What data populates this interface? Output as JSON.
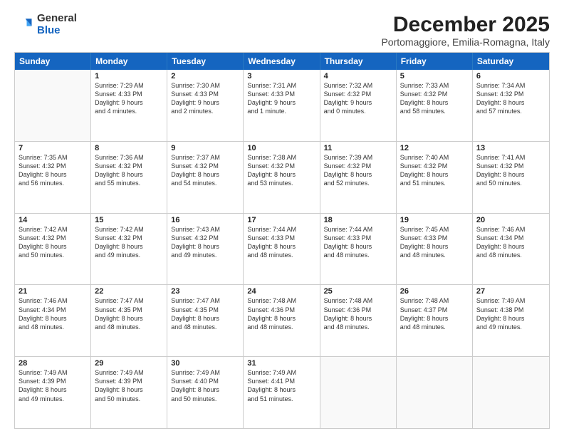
{
  "logo": {
    "general": "General",
    "blue": "Blue"
  },
  "title": "December 2025",
  "subtitle": "Portomaggiore, Emilia-Romagna, Italy",
  "header_days": [
    "Sunday",
    "Monday",
    "Tuesday",
    "Wednesday",
    "Thursday",
    "Friday",
    "Saturday"
  ],
  "rows": [
    [
      {
        "day": "",
        "lines": [],
        "empty": true
      },
      {
        "day": "1",
        "lines": [
          "Sunrise: 7:29 AM",
          "Sunset: 4:33 PM",
          "Daylight: 9 hours",
          "and 4 minutes."
        ]
      },
      {
        "day": "2",
        "lines": [
          "Sunrise: 7:30 AM",
          "Sunset: 4:33 PM",
          "Daylight: 9 hours",
          "and 2 minutes."
        ]
      },
      {
        "day": "3",
        "lines": [
          "Sunrise: 7:31 AM",
          "Sunset: 4:33 PM",
          "Daylight: 9 hours",
          "and 1 minute."
        ]
      },
      {
        "day": "4",
        "lines": [
          "Sunrise: 7:32 AM",
          "Sunset: 4:32 PM",
          "Daylight: 9 hours",
          "and 0 minutes."
        ]
      },
      {
        "day": "5",
        "lines": [
          "Sunrise: 7:33 AM",
          "Sunset: 4:32 PM",
          "Daylight: 8 hours",
          "and 58 minutes."
        ]
      },
      {
        "day": "6",
        "lines": [
          "Sunrise: 7:34 AM",
          "Sunset: 4:32 PM",
          "Daylight: 8 hours",
          "and 57 minutes."
        ]
      }
    ],
    [
      {
        "day": "7",
        "lines": [
          "Sunrise: 7:35 AM",
          "Sunset: 4:32 PM",
          "Daylight: 8 hours",
          "and 56 minutes."
        ]
      },
      {
        "day": "8",
        "lines": [
          "Sunrise: 7:36 AM",
          "Sunset: 4:32 PM",
          "Daylight: 8 hours",
          "and 55 minutes."
        ]
      },
      {
        "day": "9",
        "lines": [
          "Sunrise: 7:37 AM",
          "Sunset: 4:32 PM",
          "Daylight: 8 hours",
          "and 54 minutes."
        ]
      },
      {
        "day": "10",
        "lines": [
          "Sunrise: 7:38 AM",
          "Sunset: 4:32 PM",
          "Daylight: 8 hours",
          "and 53 minutes."
        ]
      },
      {
        "day": "11",
        "lines": [
          "Sunrise: 7:39 AM",
          "Sunset: 4:32 PM",
          "Daylight: 8 hours",
          "and 52 minutes."
        ]
      },
      {
        "day": "12",
        "lines": [
          "Sunrise: 7:40 AM",
          "Sunset: 4:32 PM",
          "Daylight: 8 hours",
          "and 51 minutes."
        ]
      },
      {
        "day": "13",
        "lines": [
          "Sunrise: 7:41 AM",
          "Sunset: 4:32 PM",
          "Daylight: 8 hours",
          "and 50 minutes."
        ]
      }
    ],
    [
      {
        "day": "14",
        "lines": [
          "Sunrise: 7:42 AM",
          "Sunset: 4:32 PM",
          "Daylight: 8 hours",
          "and 50 minutes."
        ]
      },
      {
        "day": "15",
        "lines": [
          "Sunrise: 7:42 AM",
          "Sunset: 4:32 PM",
          "Daylight: 8 hours",
          "and 49 minutes."
        ]
      },
      {
        "day": "16",
        "lines": [
          "Sunrise: 7:43 AM",
          "Sunset: 4:32 PM",
          "Daylight: 8 hours",
          "and 49 minutes."
        ]
      },
      {
        "day": "17",
        "lines": [
          "Sunrise: 7:44 AM",
          "Sunset: 4:33 PM",
          "Daylight: 8 hours",
          "and 48 minutes."
        ]
      },
      {
        "day": "18",
        "lines": [
          "Sunrise: 7:44 AM",
          "Sunset: 4:33 PM",
          "Daylight: 8 hours",
          "and 48 minutes."
        ]
      },
      {
        "day": "19",
        "lines": [
          "Sunrise: 7:45 AM",
          "Sunset: 4:33 PM",
          "Daylight: 8 hours",
          "and 48 minutes."
        ]
      },
      {
        "day": "20",
        "lines": [
          "Sunrise: 7:46 AM",
          "Sunset: 4:34 PM",
          "Daylight: 8 hours",
          "and 48 minutes."
        ]
      }
    ],
    [
      {
        "day": "21",
        "lines": [
          "Sunrise: 7:46 AM",
          "Sunset: 4:34 PM",
          "Daylight: 8 hours",
          "and 48 minutes."
        ]
      },
      {
        "day": "22",
        "lines": [
          "Sunrise: 7:47 AM",
          "Sunset: 4:35 PM",
          "Daylight: 8 hours",
          "and 48 minutes."
        ]
      },
      {
        "day": "23",
        "lines": [
          "Sunrise: 7:47 AM",
          "Sunset: 4:35 PM",
          "Daylight: 8 hours",
          "and 48 minutes."
        ]
      },
      {
        "day": "24",
        "lines": [
          "Sunrise: 7:48 AM",
          "Sunset: 4:36 PM",
          "Daylight: 8 hours",
          "and 48 minutes."
        ]
      },
      {
        "day": "25",
        "lines": [
          "Sunrise: 7:48 AM",
          "Sunset: 4:36 PM",
          "Daylight: 8 hours",
          "and 48 minutes."
        ]
      },
      {
        "day": "26",
        "lines": [
          "Sunrise: 7:48 AM",
          "Sunset: 4:37 PM",
          "Daylight: 8 hours",
          "and 48 minutes."
        ]
      },
      {
        "day": "27",
        "lines": [
          "Sunrise: 7:49 AM",
          "Sunset: 4:38 PM",
          "Daylight: 8 hours",
          "and 49 minutes."
        ]
      }
    ],
    [
      {
        "day": "28",
        "lines": [
          "Sunrise: 7:49 AM",
          "Sunset: 4:39 PM",
          "Daylight: 8 hours",
          "and 49 minutes."
        ]
      },
      {
        "day": "29",
        "lines": [
          "Sunrise: 7:49 AM",
          "Sunset: 4:39 PM",
          "Daylight: 8 hours",
          "and 50 minutes."
        ]
      },
      {
        "day": "30",
        "lines": [
          "Sunrise: 7:49 AM",
          "Sunset: 4:40 PM",
          "Daylight: 8 hours",
          "and 50 minutes."
        ]
      },
      {
        "day": "31",
        "lines": [
          "Sunrise: 7:49 AM",
          "Sunset: 4:41 PM",
          "Daylight: 8 hours",
          "and 51 minutes."
        ]
      },
      {
        "day": "",
        "lines": [],
        "empty": true
      },
      {
        "day": "",
        "lines": [],
        "empty": true
      },
      {
        "day": "",
        "lines": [],
        "empty": true
      }
    ]
  ]
}
